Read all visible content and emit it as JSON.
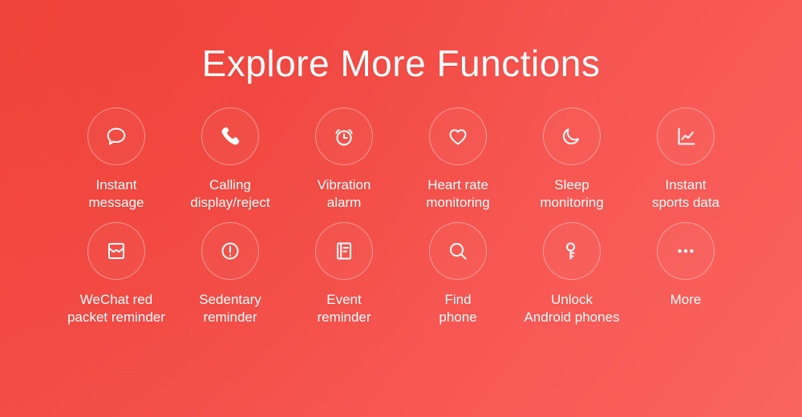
{
  "page": {
    "title": "Explore More Functions",
    "background_gradient_from": "#F1473D",
    "background_gradient_to": "#FA645F",
    "text_color": "#FFFFFF",
    "circle_border_color": "rgba(255,255,255,0.42)"
  },
  "features": {
    "row1": [
      {
        "icon": "chat-bubble-icon",
        "label": "Instant\nmessage"
      },
      {
        "icon": "phone-handset-icon",
        "label": "Calling\ndisplay/reject"
      },
      {
        "icon": "alarm-clock-icon",
        "label": "Vibration\nalarm"
      },
      {
        "icon": "heart-icon",
        "label": "Heart rate\nmonitoring"
      },
      {
        "icon": "crescent-moon-icon",
        "label": "Sleep\nmonitoring"
      },
      {
        "icon": "line-chart-icon",
        "label": "Instant\nsports data"
      }
    ],
    "row2": [
      {
        "icon": "envelope-icon",
        "label": "WeChat red\npacket reminder"
      },
      {
        "icon": "exclamation-circle-icon",
        "label": "Sedentary\nreminder"
      },
      {
        "icon": "document-icon",
        "label": "Event\nreminder"
      },
      {
        "icon": "magnifier-icon",
        "label": "Find\nphone"
      },
      {
        "icon": "key-icon",
        "label": "Unlock\nAndroid phones"
      },
      {
        "icon": "ellipsis-icon",
        "label": "More"
      }
    ]
  }
}
